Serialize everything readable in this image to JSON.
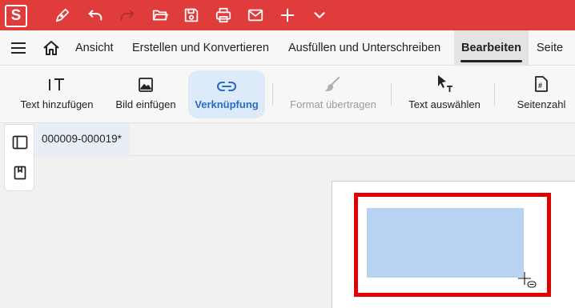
{
  "app": {
    "logo_letter": "S",
    "accent_color": "#e13c3c"
  },
  "quick_access": [
    "pen-icon",
    "undo-icon",
    "redo-icon",
    "open-folder-icon",
    "save-icon",
    "print-icon",
    "mail-icon",
    "add-icon",
    "chevron-down-icon"
  ],
  "tabs": {
    "items": [
      {
        "label": "Ansicht"
      },
      {
        "label": "Erstellen und Konvertieren"
      },
      {
        "label": "Ausfüllen und Unterschreiben"
      },
      {
        "label": "Bearbeiten",
        "active": true
      },
      {
        "label": "Seite"
      }
    ]
  },
  "toolbar": {
    "items": [
      {
        "label": "Text hinzufügen",
        "icon": "add-text-icon"
      },
      {
        "label": "Bild einfügen",
        "icon": "image-icon"
      },
      {
        "label": "Verknüpfung",
        "icon": "link-icon",
        "active": true
      },
      {
        "label": "Format übertragen",
        "icon": "brush-icon",
        "disabled": true
      },
      {
        "label": "Text auswählen",
        "icon": "select-text-icon"
      },
      {
        "label": "Seitenzahl",
        "icon": "page-number-icon"
      }
    ]
  },
  "document": {
    "tab_title": "000009-000019*"
  },
  "colors": {
    "link_area": "#b8d3f1",
    "highlight_border": "#e00000",
    "active_tool_bg": "#dceaf9",
    "active_tool_text": "#2a6cc4"
  }
}
